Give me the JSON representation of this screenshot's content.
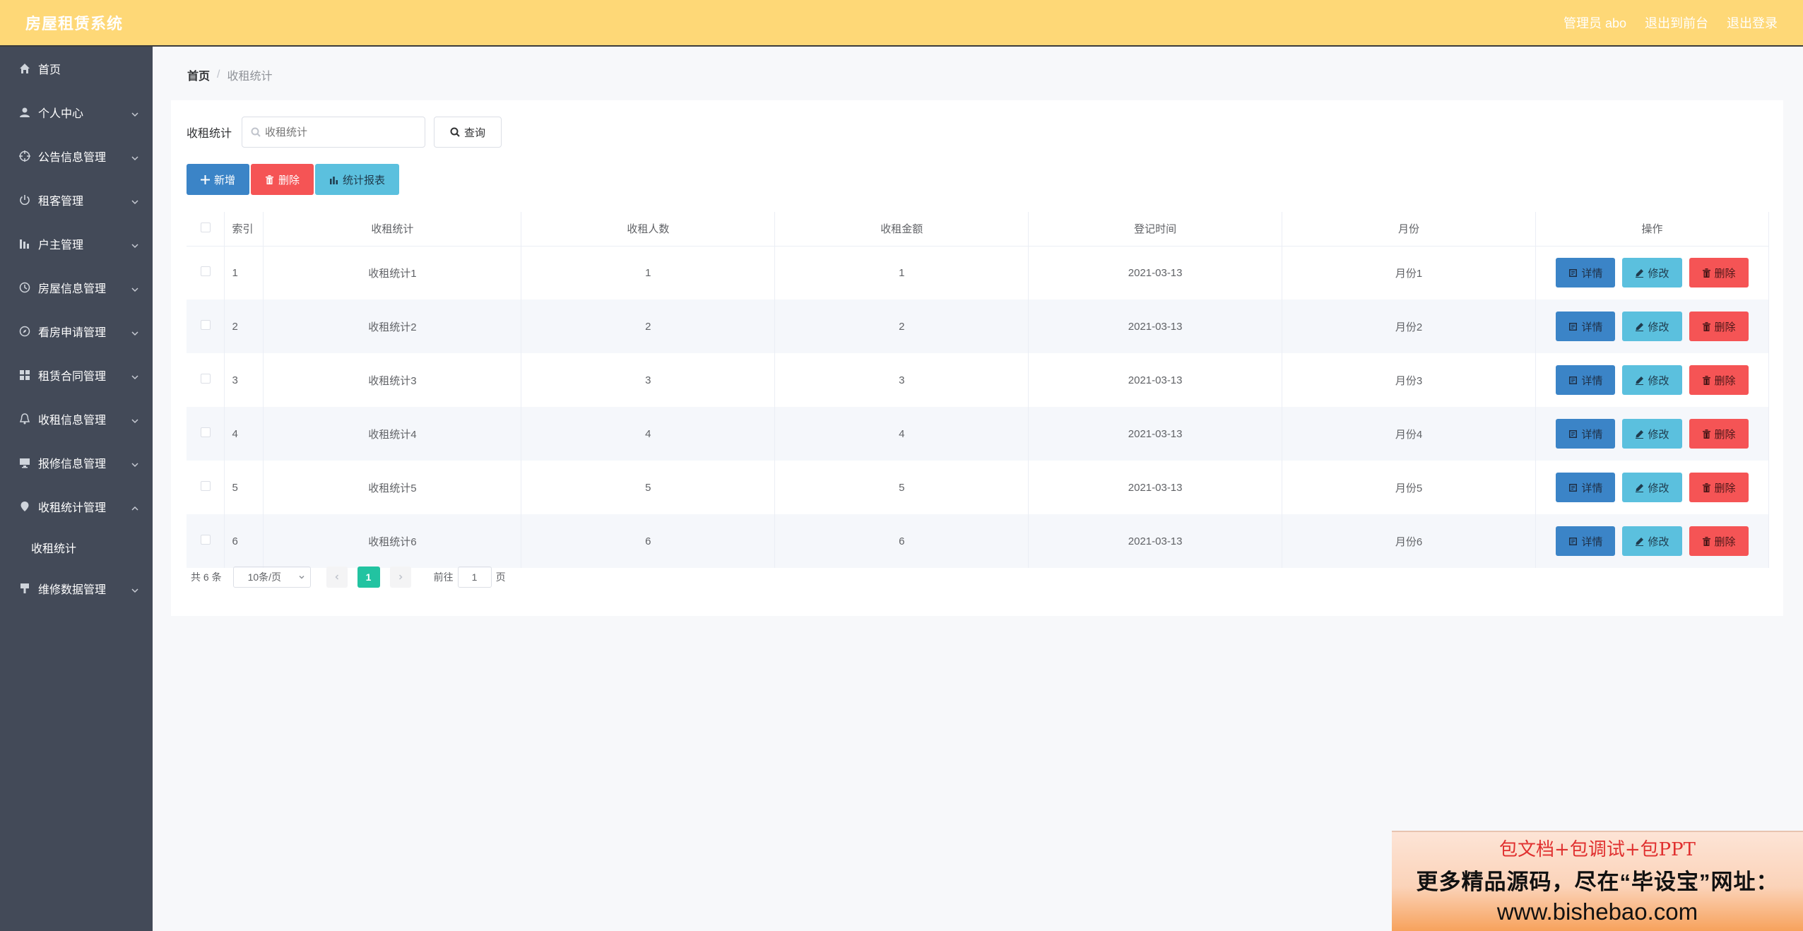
{
  "header": {
    "title": "房屋租赁系统",
    "user": "管理员 abo",
    "to_front": "退出到前台",
    "logout": "退出登录"
  },
  "sidebar": {
    "items": [
      {
        "label": "首页",
        "icon": "home-icon",
        "expandable": false
      },
      {
        "label": "个人中心",
        "icon": "user-icon",
        "expandable": true
      },
      {
        "label": "公告信息管理",
        "icon": "target-icon",
        "expandable": true
      },
      {
        "label": "租客管理",
        "icon": "power-icon",
        "expandable": true
      },
      {
        "label": "户主管理",
        "icon": "bars-icon",
        "expandable": true
      },
      {
        "label": "房屋信息管理",
        "icon": "clock-icon",
        "expandable": true
      },
      {
        "label": "看房申请管理",
        "icon": "compass-icon",
        "expandable": true
      },
      {
        "label": "租赁合同管理",
        "icon": "grid-icon",
        "expandable": true
      },
      {
        "label": "收租信息管理",
        "icon": "bell-icon",
        "expandable": true
      },
      {
        "label": "报修信息管理",
        "icon": "monitor-icon",
        "expandable": true
      },
      {
        "label": "收租统计管理",
        "icon": "location-icon",
        "expandable": true,
        "expanded": true
      },
      {
        "label": "维修数据管理",
        "icon": "brush-icon",
        "expandable": true
      }
    ],
    "sub_item": "收租统计"
  },
  "breadcrumb": {
    "home": "首页",
    "sep": "/",
    "current": "收租统计"
  },
  "search": {
    "label": "收租统计",
    "placeholder": "收租统计",
    "button": "查询"
  },
  "actions": {
    "add": "新增",
    "delete": "删除",
    "report": "统计报表"
  },
  "table": {
    "headers": {
      "index": "索引",
      "name": "收租统计",
      "count": "收租人数",
      "amount": "收租金额",
      "time": "登记时间",
      "month": "月份",
      "ops": "操作"
    },
    "rows": [
      {
        "index": "1",
        "name": "收租统计1",
        "count": "1",
        "amount": "1",
        "time": "2021-03-13",
        "month": "月份1"
      },
      {
        "index": "2",
        "name": "收租统计2",
        "count": "2",
        "amount": "2",
        "time": "2021-03-13",
        "month": "月份2"
      },
      {
        "index": "3",
        "name": "收租统计3",
        "count": "3",
        "amount": "3",
        "time": "2021-03-13",
        "month": "月份3"
      },
      {
        "index": "4",
        "name": "收租统计4",
        "count": "4",
        "amount": "4",
        "time": "2021-03-13",
        "month": "月份4"
      },
      {
        "index": "5",
        "name": "收租统计5",
        "count": "5",
        "amount": "5",
        "time": "2021-03-13",
        "month": "月份5"
      },
      {
        "index": "6",
        "name": "收租统计6",
        "count": "6",
        "amount": "6",
        "time": "2021-03-13",
        "month": "月份6"
      }
    ],
    "op_labels": {
      "detail": "详情",
      "edit": "修改",
      "delete": "删除"
    }
  },
  "pagination": {
    "total": "共 6 条",
    "page_size": "10条/页",
    "current": "1",
    "goto_prefix": "前往",
    "goto_value": "1",
    "goto_suffix": "页"
  },
  "promo": {
    "line1": "包文档+包调试+包PPT",
    "line2": "更多精品源码，尽在“毕设宝”网址：",
    "line3": "www.bishebao.com"
  }
}
